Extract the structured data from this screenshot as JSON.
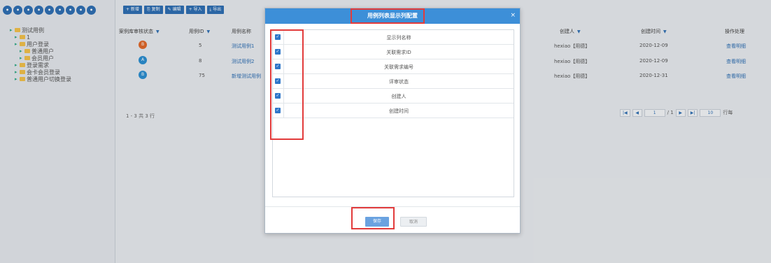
{
  "left_toolbar": {
    "icons": [
      "refresh-icon",
      "add-icon",
      "edit-icon",
      "delete-icon",
      "up-icon",
      "down-icon",
      "expand-icon",
      "collapse-icon",
      "settings-icon"
    ]
  },
  "tree": {
    "items": [
      {
        "label": "测试用例",
        "level": 0
      },
      {
        "label": "1",
        "level": 1
      },
      {
        "label": "用户登录",
        "level": 1
      },
      {
        "label": "普通用户",
        "level": 2
      },
      {
        "label": "会员用户",
        "level": 2
      },
      {
        "label": "登录需求",
        "level": 1
      },
      {
        "label": "会卡会员登录",
        "level": 1
      },
      {
        "label": "普通用户切换登录",
        "level": 1
      }
    ]
  },
  "grid": {
    "headers": {
      "status": "案例库审核状态",
      "id": "用例ID",
      "name": "用例名称",
      "creator": "创建人",
      "created": "创建时间",
      "actions": "操作处理"
    },
    "rows": [
      {
        "status_color": "#e0692b",
        "status_letter": "B",
        "id": "5",
        "name": "测试用例1",
        "creator": "hexiao【用德】",
        "created": "2020-12-09",
        "action": "查看明细"
      },
      {
        "status_color": "#2c8fd1",
        "status_letter": "A",
        "id": "8",
        "name": "测试用例2",
        "creator": "hexiao【用德】",
        "created": "2020-12-09",
        "action": "查看明细"
      },
      {
        "status_color": "#2c8fd1",
        "status_letter": "B",
        "id": "75",
        "name": "新增测试用例",
        "creator": "hexiao【用德】",
        "created": "2020-12-31",
        "action": "查看明细"
      }
    ],
    "pager_info": "1 - 3 共 3 行",
    "pager": {
      "page": "1",
      "total": "/ 1",
      "size": "10",
      "unit": "行每"
    }
  },
  "dialog": {
    "title": "用例列表显示列配置",
    "close": "×",
    "rows": [
      {
        "label": "显示列名称",
        "checked": true
      },
      {
        "label": "关联需求ID",
        "checked": true
      },
      {
        "label": "关联需求编号",
        "checked": true
      },
      {
        "label": "评审状态",
        "checked": true
      },
      {
        "label": "创建人",
        "checked": true
      },
      {
        "label": "创建时间",
        "checked": true
      }
    ],
    "save": "保存",
    "cancel": "取消"
  }
}
